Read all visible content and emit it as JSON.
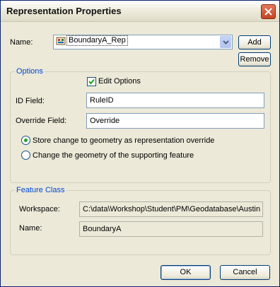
{
  "window": {
    "title": "Representation Properties"
  },
  "name_row": {
    "label": "Name:",
    "value": "BoundaryA_Rep",
    "add_label": "Add",
    "remove_label": "Remove"
  },
  "options": {
    "legend": "Options",
    "edit_options_label": "Edit Options",
    "edit_options_checked": true,
    "id_field_label": "ID Field:",
    "id_field_value": "RuleID",
    "override_field_label": "Override Field:",
    "override_field_value": "Override",
    "radio_store_label": "Store change to geometry as representation override",
    "radio_change_label": "Change the geometry of the supporting feature",
    "selected_radio": "store"
  },
  "feature_class": {
    "legend": "Feature Class",
    "workspace_label": "Workspace:",
    "workspace_value": "C:\\data\\Workshop\\Student\\PM\\Geodatabase\\Austin",
    "name_label": "Name:",
    "name_value": "BoundaryA"
  },
  "footer": {
    "ok_label": "OK",
    "cancel_label": "Cancel"
  },
  "colors": {
    "title_close": "#c24424",
    "legend_text": "#0046d5",
    "selection": "#316ac5"
  }
}
